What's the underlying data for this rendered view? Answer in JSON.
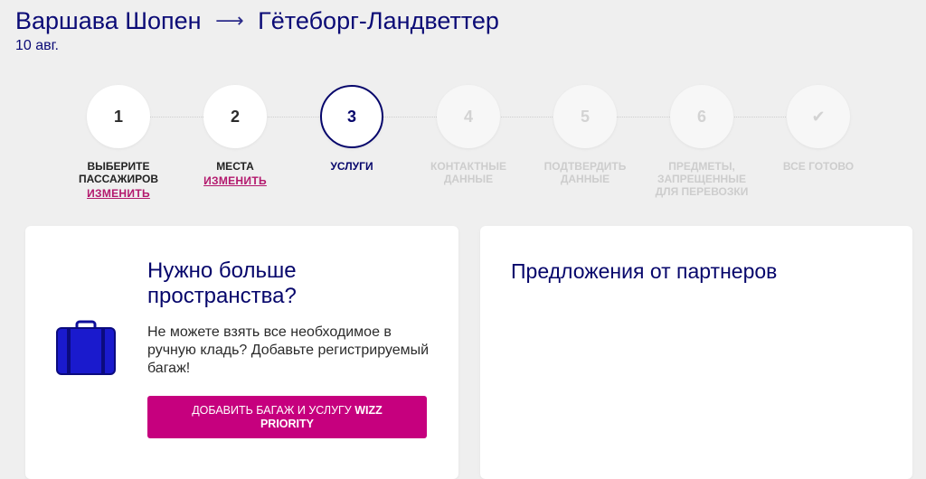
{
  "header": {
    "origin": "Варшава Шопен",
    "arrow": "⟶",
    "destination": "Гётеборг-Ландветтер",
    "date": "10 авг."
  },
  "stepper": {
    "edit_label": "ИЗМЕНИТЬ",
    "steps": [
      {
        "number": "1",
        "label": "ВЫБЕРИТЕ ПАССАЖИРОВ"
      },
      {
        "number": "2",
        "label": "МЕСТА"
      },
      {
        "number": "3",
        "label": "УСЛУГИ"
      },
      {
        "number": "4",
        "label": "КОНТАКТНЫЕ ДАННЫЕ"
      },
      {
        "number": "5",
        "label": "ПОДТВЕРДИТЬ ДАННЫЕ"
      },
      {
        "number": "6",
        "label": "ПРЕДМЕТЫ, ЗАПРЕЩЕННЫЕ ДЛЯ ПЕРЕВОЗКИ"
      },
      {
        "number": "✔",
        "label": "ВСЕ ГОТОВО"
      }
    ]
  },
  "baggage_card": {
    "title": "Нужно больше пространства?",
    "text": "Не можете взять все необходимое в ручную кладь? Добавьте регистрируемый багаж!",
    "button_prefix": "ДОБАВИТЬ БАГАЖ И УСЛУГУ",
    "button_bold": "WIZZ PRIORITY",
    "icon": "suitcase-icon"
  },
  "partners_card": {
    "title": "Предложения от партнеров"
  },
  "colors": {
    "brand_navy": "#06066b",
    "brand_magenta": "#c6007e",
    "suitcase_blue": "#1a1acd"
  }
}
